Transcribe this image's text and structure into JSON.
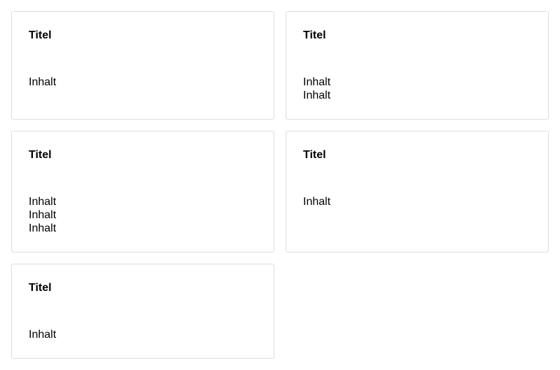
{
  "cards": [
    {
      "title": "Titel",
      "lines": [
        "Inhalt"
      ]
    },
    {
      "title": "Titel",
      "lines": [
        "Inhalt",
        "Inhalt"
      ]
    },
    {
      "title": "Titel",
      "lines": [
        "Inhalt",
        "Inhalt",
        "Inhalt"
      ]
    },
    {
      "title": "Titel",
      "lines": [
        "Inhalt"
      ]
    },
    {
      "title": "Titel",
      "lines": [
        "Inhalt"
      ]
    }
  ]
}
